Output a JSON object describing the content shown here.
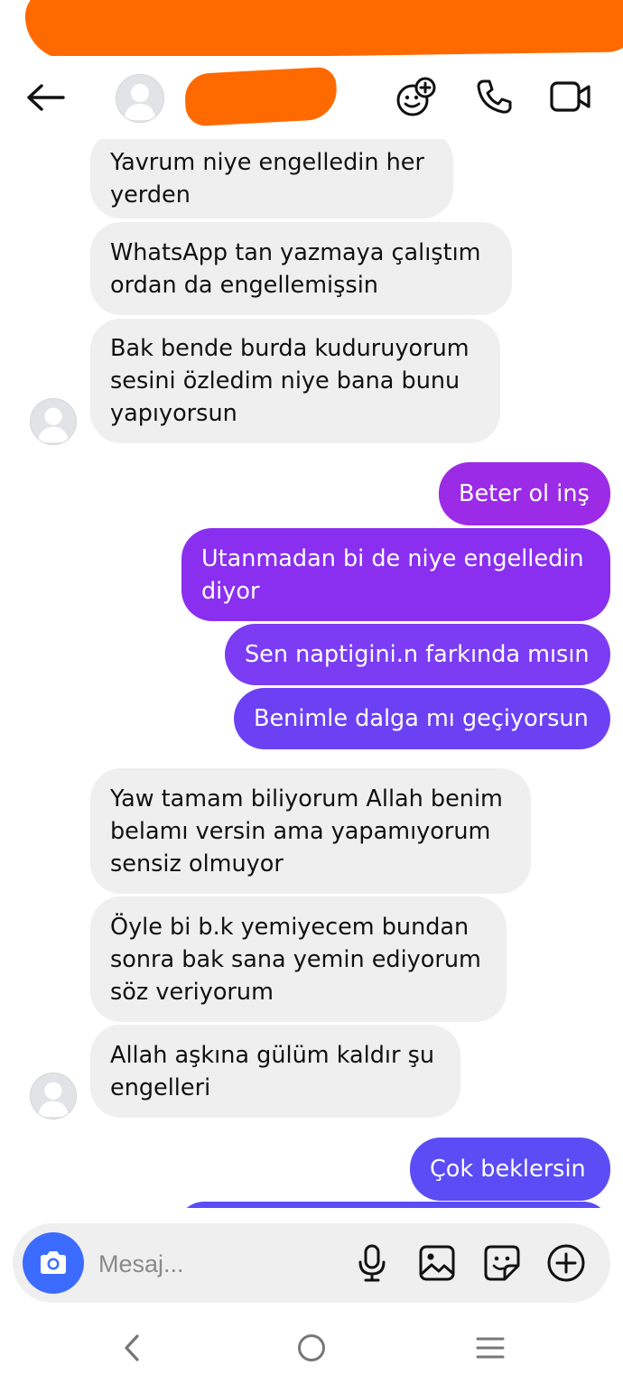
{
  "header": {
    "back_icon": "arrow-left-icon",
    "avatar_icon": "default-avatar-icon",
    "actions": [
      {
        "name": "effects-icon"
      },
      {
        "name": "phone-icon"
      },
      {
        "name": "video-icon"
      }
    ]
  },
  "messages": {
    "m1": "Yavrum niye engelledin her\nyerden",
    "m2": "WhatsApp tan yazmaya çalıştım\nordan da engellemişsin",
    "m3": "Bak bende burda kuduruyorum\nsesini özledim niye bana bunu\nyapıyorsun",
    "m4": "Beter ol inş",
    "m5": "Utanmadan bi de niye engelledin\ndiyor",
    "m6": "Sen naptigini.n farkında mısın",
    "m7": "Benimle dalga mı geçiyorsun",
    "m8": "Yaw tamam biliyorum Allah benim\nbelamı versin ama yapamıyorum\nsensiz olmuyor",
    "m9": "Öyle bi b.k yemiyecem bundan\nsonra bak sana yemin ediyorum\nsöz veriyorum",
    "m10": "Allah aşkına gülüm kaldır şu\nengelleri",
    "m11": "Çok beklersin"
  },
  "composer": {
    "placeholder": "Mesaj...",
    "icons": [
      "camera-icon",
      "microphone-icon",
      "gallery-icon",
      "sticker-icon",
      "plus-icon"
    ]
  },
  "colors": {
    "incoming_bubble": "#efefef",
    "out_purple_1": "#9b2be6",
    "out_purple_2": "#8a2ff0",
    "out_purple_3": "#7b3cf3",
    "out_blue": "#5b4cf5",
    "camera_blue": "#3b6cff",
    "redaction": "#ff6a00"
  },
  "nav": {
    "icons": [
      "back-nav-icon",
      "home-nav-icon",
      "recents-nav-icon"
    ]
  }
}
